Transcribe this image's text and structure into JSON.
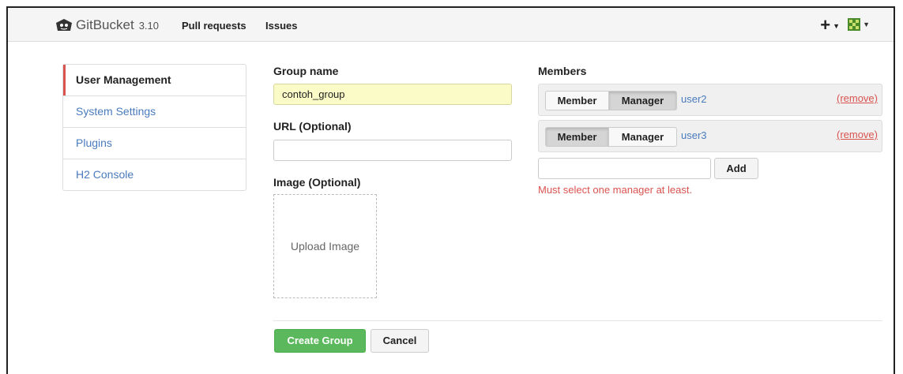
{
  "navbar": {
    "brand": "GitBucket",
    "version": "3.10",
    "links": [
      "Pull requests",
      "Issues"
    ],
    "plus": "+"
  },
  "sidebar": {
    "items": [
      {
        "label": "User Management",
        "active": true
      },
      {
        "label": "System Settings",
        "active": false
      },
      {
        "label": "Plugins",
        "active": false
      },
      {
        "label": "H2 Console",
        "active": false
      }
    ]
  },
  "form": {
    "group_name_label": "Group name",
    "group_name_value": "contoh_group",
    "url_label": "URL (Optional)",
    "url_value": "",
    "image_label": "Image (Optional)",
    "upload_label": "Upload Image",
    "create_button": "Create Group",
    "cancel_button": "Cancel"
  },
  "members": {
    "label": "Members",
    "member_option": "Member",
    "manager_option": "Manager",
    "remove_label": "(remove)",
    "rows": [
      {
        "name": "user2",
        "role": "Manager"
      },
      {
        "name": "user3",
        "role": "Member"
      }
    ],
    "add_input_value": "",
    "add_button": "Add",
    "error": "Must select one manager at least."
  },
  "colors": {
    "accent_red": "#d9534f",
    "link_blue": "#4a7bbd",
    "button_green": "#5cb85c",
    "filled_input": "#fbfbc8"
  }
}
